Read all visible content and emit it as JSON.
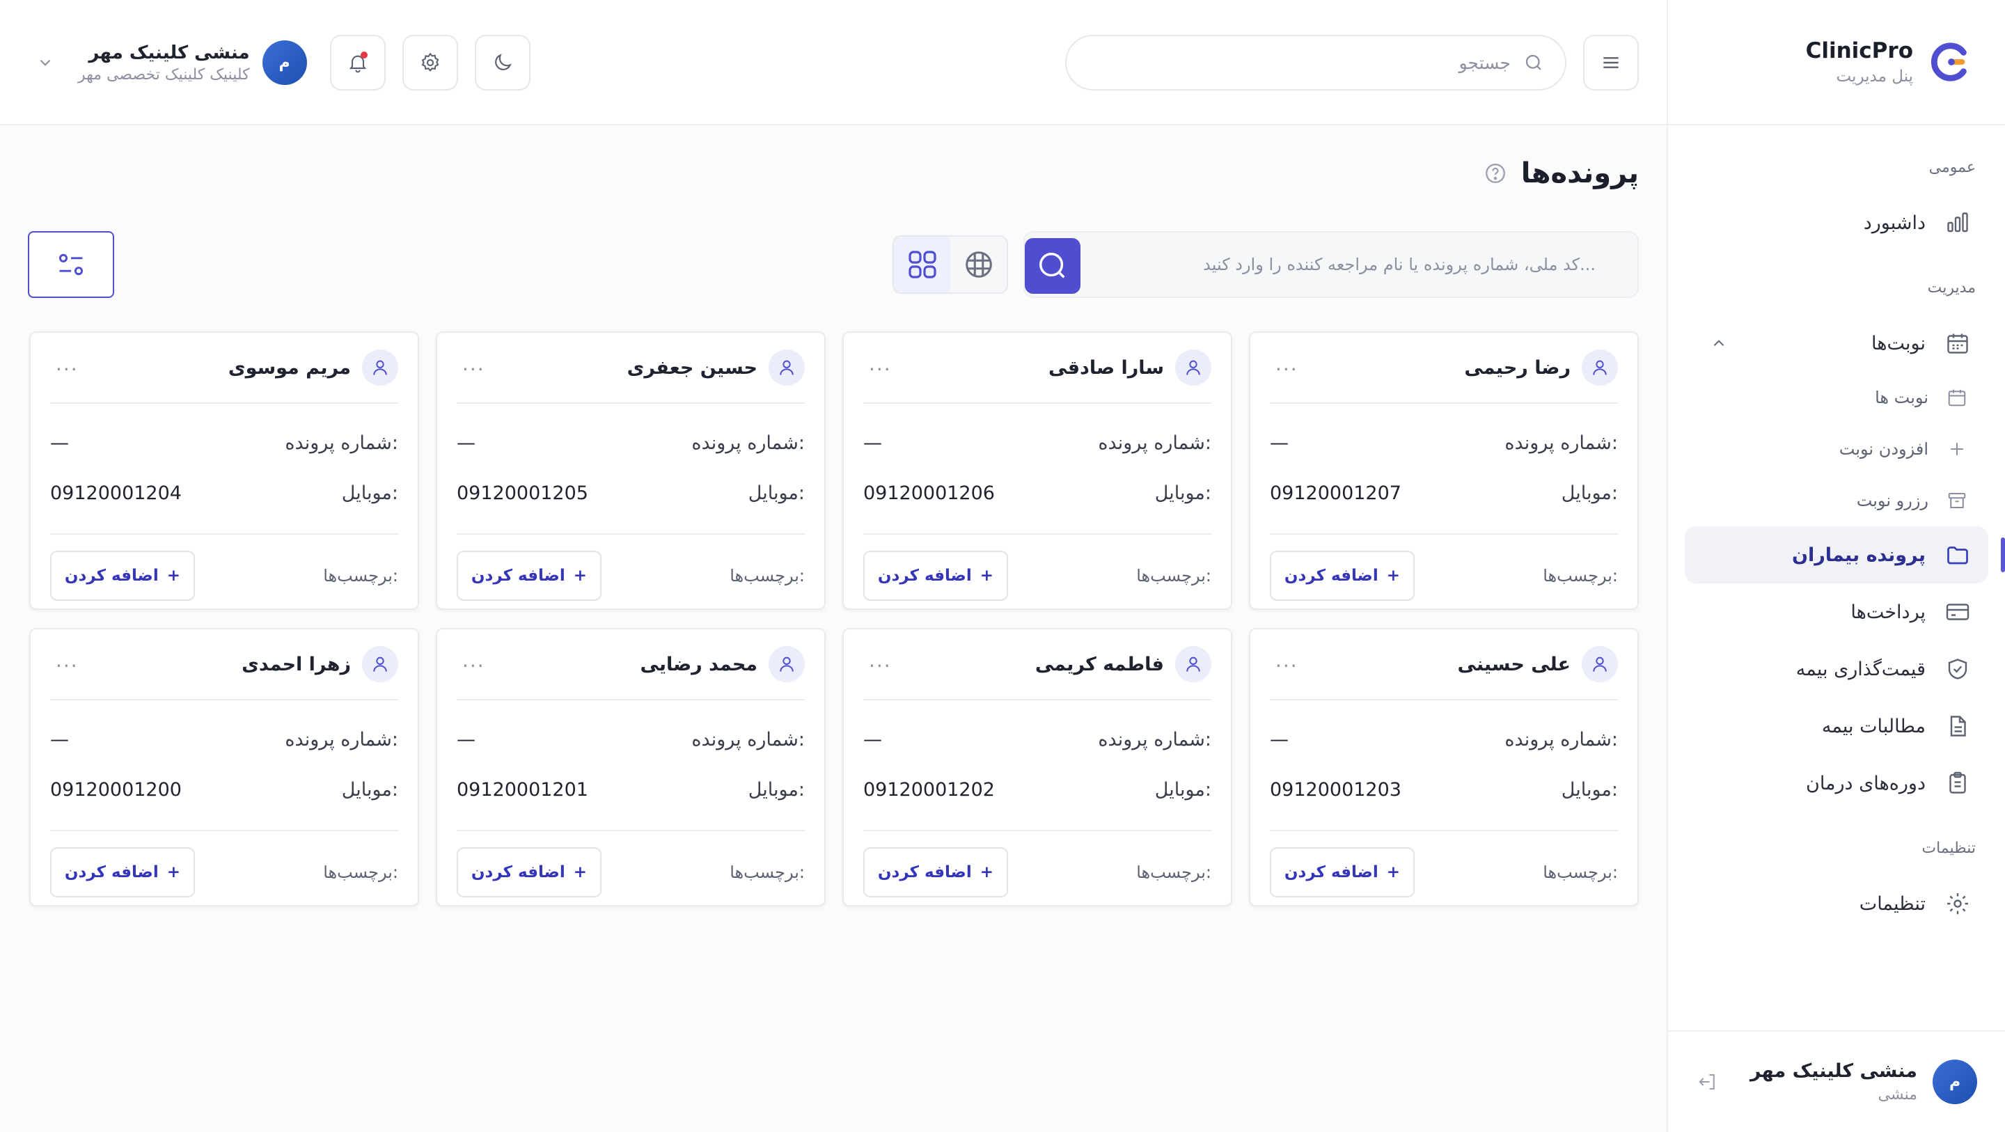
{
  "brand": {
    "name": "ClinicPro",
    "subtitle": "پنل مدیریت"
  },
  "header": {
    "search_placeholder": "جستجو",
    "user": {
      "name": "منشی کلینیک مهر",
      "subtitle": "کلینیک کلینیک تخصصی مهر",
      "avatar_letter": "م"
    }
  },
  "sidebar": {
    "section_general": "عمومی",
    "dashboard": "داشبورد",
    "section_management": "مدیریت",
    "appointments": "نوبت‌ها",
    "sub_appointments": "نوبت ها",
    "sub_add": "افزودن نوبت",
    "sub_reserve": "رزرو نوبت",
    "patients": "پرونده بیماران",
    "payments": "پرداخت‌ها",
    "insurance_pricing": "قیمت‌گذاری بیمه",
    "insurance_claims": "مطالبات بیمه",
    "treatment_courses": "دوره‌های درمان",
    "section_settings": "تنظیمات",
    "settings": "تنظیمات",
    "footer": {
      "name": "منشی کلینیک مهر",
      "role": "منشی",
      "avatar_letter": "م"
    }
  },
  "page": {
    "title": "پرونده‌ها",
    "search_placeholder": "کد ملی، شماره پرونده یا نام مراجعه کننده را وارد کنید..."
  },
  "card_labels": {
    "file_no": "شماره پرونده:",
    "mobile": "موبایل:",
    "tags": "برچسب‌ها:",
    "add": "اضافه کردن",
    "empty": "—",
    "more": "···"
  },
  "patients": [
    {
      "name": "رضا رحیمی",
      "mobile": "09120001207"
    },
    {
      "name": "سارا صادقی",
      "mobile": "09120001206"
    },
    {
      "name": "حسین جعفری",
      "mobile": "09120001205"
    },
    {
      "name": "مریم موسوی",
      "mobile": "09120001204"
    },
    {
      "name": "علی حسینی",
      "mobile": "09120001203"
    },
    {
      "name": "فاطمه کریمی",
      "mobile": "09120001202"
    },
    {
      "name": "محمد رضایی",
      "mobile": "09120001201"
    },
    {
      "name": "زهرا احمدی",
      "mobile": "09120001200"
    }
  ],
  "colors": {
    "accent": "#4f4ed1",
    "notification": "#e53946"
  }
}
